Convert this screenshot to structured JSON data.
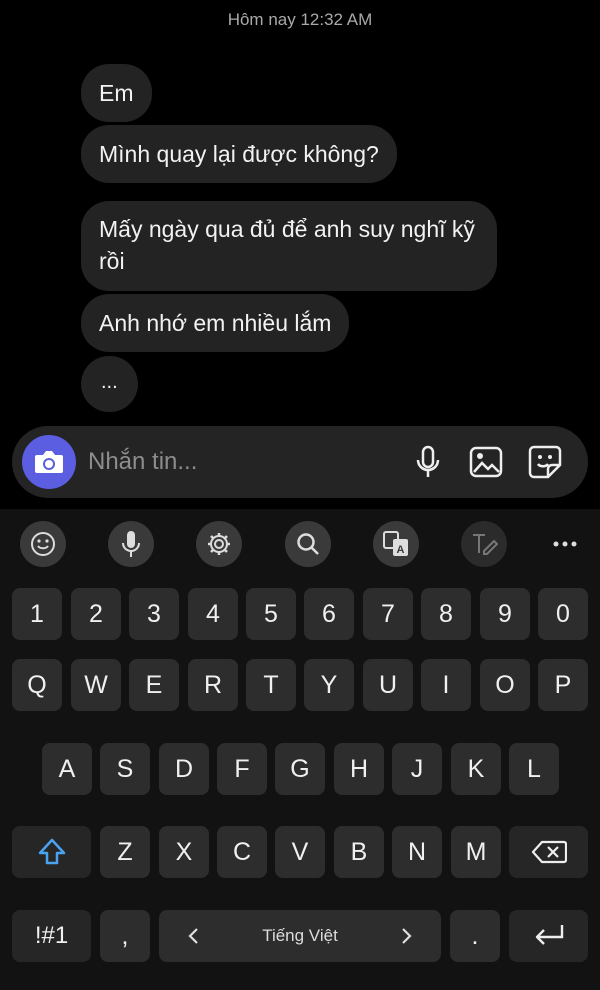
{
  "chat": {
    "timestamp": "Hôm nay 12:32 AM",
    "messages": [
      "Em",
      "Mình quay lại được không?",
      "Mấy ngày qua đủ để anh suy nghĩ kỹ rồi",
      "Anh nhớ em nhiều lắm",
      "..."
    ]
  },
  "composer": {
    "placeholder": "Nhắn tin...",
    "camera_icon": "camera-icon",
    "icons": [
      "mic-icon",
      "gallery-icon",
      "sticker-icon"
    ]
  },
  "keyboard": {
    "toolbar_icons": [
      "emoji-icon",
      "voice-input-icon",
      "settings-icon",
      "search-icon",
      "translate-icon",
      "handwriting-icon",
      "more-icon"
    ],
    "number_row": [
      "1",
      "2",
      "3",
      "4",
      "5",
      "6",
      "7",
      "8",
      "9",
      "0"
    ],
    "row1": [
      "Q",
      "W",
      "E",
      "R",
      "T",
      "Y",
      "U",
      "I",
      "O",
      "P"
    ],
    "row2": [
      "A",
      "S",
      "D",
      "F",
      "G",
      "H",
      "J",
      "K",
      "L"
    ],
    "row3": [
      "Z",
      "X",
      "C",
      "V",
      "B",
      "N",
      "M"
    ],
    "symbols_key": "!#1",
    "comma_key": ",",
    "space_label": "Tiếng Việt",
    "period_key": ".",
    "colors": {
      "accent": "#5b5ee0",
      "key": "#2d2d2d",
      "bubble": "#232323"
    }
  }
}
